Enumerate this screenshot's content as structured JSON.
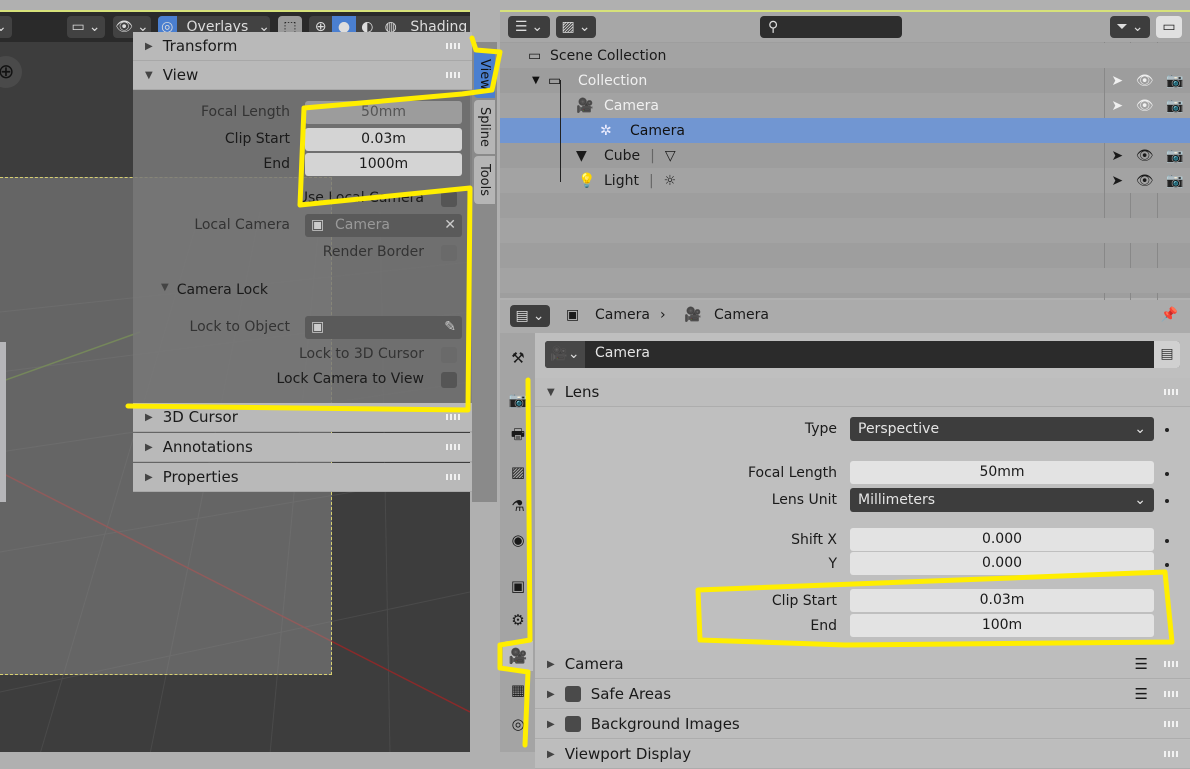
{
  "viewport": {
    "header": {
      "overlays_label": "Overlays",
      "shading_label": "Shading"
    },
    "npanel": {
      "sections": [
        "Transform",
        "View",
        "3D Cursor",
        "Annotations",
        "Properties"
      ],
      "view": {
        "focal_length_label": "Focal Length",
        "focal_length": "50mm",
        "clip_start_label": "Clip Start",
        "clip_start": "0.03m",
        "end_label": "End",
        "end": "1000m",
        "use_local_camera": "Use Local Camera",
        "local_camera_label": "Local Camera",
        "local_camera": "Camera",
        "render_border": "Render Border",
        "camera_lock": "Camera Lock",
        "lock_to_object": "Lock to Object",
        "lock_to_3d_cursor": "Lock to 3D Cursor",
        "lock_camera_to_view": "Lock Camera to View"
      },
      "tabs": [
        "View",
        "Spline",
        "Tools"
      ]
    }
  },
  "outliner": {
    "rows": [
      {
        "label": "Scene Collection"
      },
      {
        "label": "Collection"
      },
      {
        "label": "Camera"
      },
      {
        "label": "Camera"
      },
      {
        "label": "Cube"
      },
      {
        "label": "Light"
      }
    ]
  },
  "properties": {
    "breadcrumb": [
      "Camera",
      "Camera"
    ],
    "datablock_name": "Camera",
    "lens": {
      "title": "Lens",
      "type_label": "Type",
      "type": "Perspective",
      "focal_length_label": "Focal Length",
      "focal_length": "50mm",
      "lens_unit_label": "Lens Unit",
      "lens_unit": "Millimeters",
      "shift_x_label": "Shift X",
      "shift_x": "0.000",
      "y_label": "Y",
      "y": "0.000",
      "clip_start_label": "Clip Start",
      "clip_start": "0.03m",
      "end_label": "End",
      "end": "100m"
    },
    "panels": [
      "Camera",
      "Safe Areas",
      "Background Images",
      "Viewport Display"
    ]
  },
  "colors": {
    "selected": "#7196d2",
    "annotation": "#ffee00",
    "accent": "#4a7fd0"
  }
}
